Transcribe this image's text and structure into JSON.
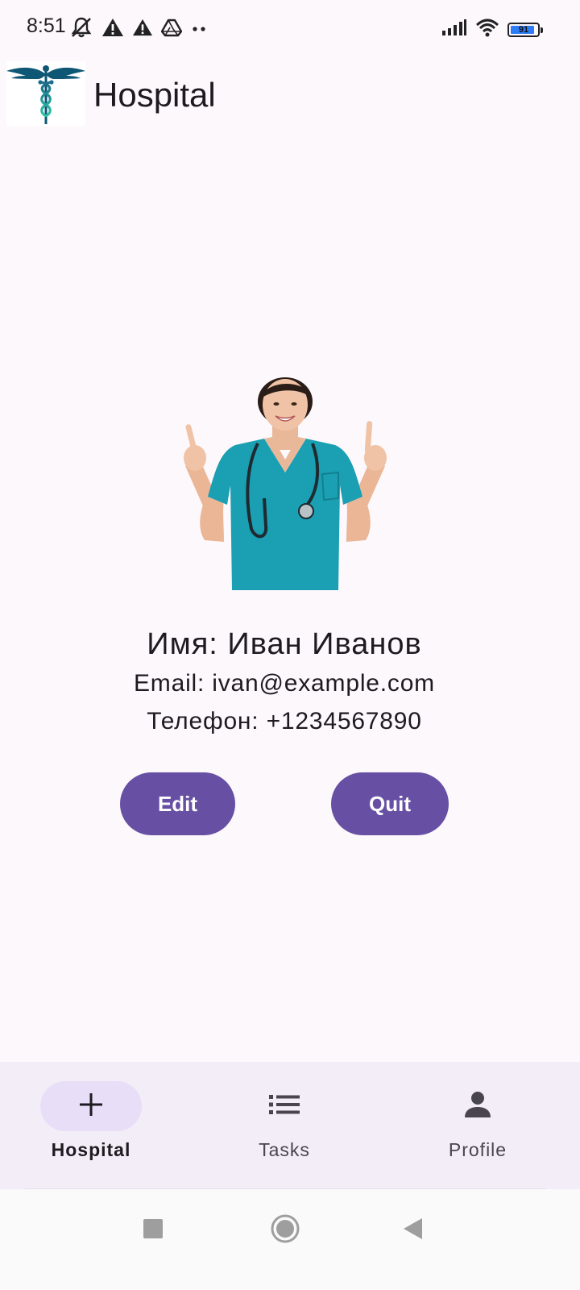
{
  "status_bar": {
    "time": "8:51",
    "battery_level": "91",
    "icons": [
      "bell-off-icon",
      "warning-icon",
      "warning-icon",
      "drive-icon",
      "more-dots-icon",
      "signal-icon",
      "wifi-icon",
      "battery-icon"
    ]
  },
  "app_bar": {
    "title": "Hospital",
    "logo": "caduceus-logo"
  },
  "profile": {
    "name": "Имя: Иван Иванов",
    "email": "Email: ivan@example.com",
    "phone": "Телефон: +1234567890",
    "photo": "doctor-photo"
  },
  "actions": {
    "edit_label": "Edit",
    "quit_label": "Quit"
  },
  "bottom_nav": {
    "items": [
      {
        "label": "Hospital",
        "icon": "plus-icon",
        "active": true
      },
      {
        "label": "Tasks",
        "icon": "list-icon",
        "active": false
      },
      {
        "label": "Profile",
        "icon": "person-icon",
        "active": false
      }
    ]
  },
  "system_nav": {
    "buttons": [
      "recents-icon",
      "home-icon",
      "back-icon"
    ]
  },
  "colors": {
    "background": "#fdf8fc",
    "primary": "#6750a4",
    "nav_background": "#f3edf7",
    "nav_active_pill": "#e8def8",
    "battery_fill": "#2d7df6"
  }
}
